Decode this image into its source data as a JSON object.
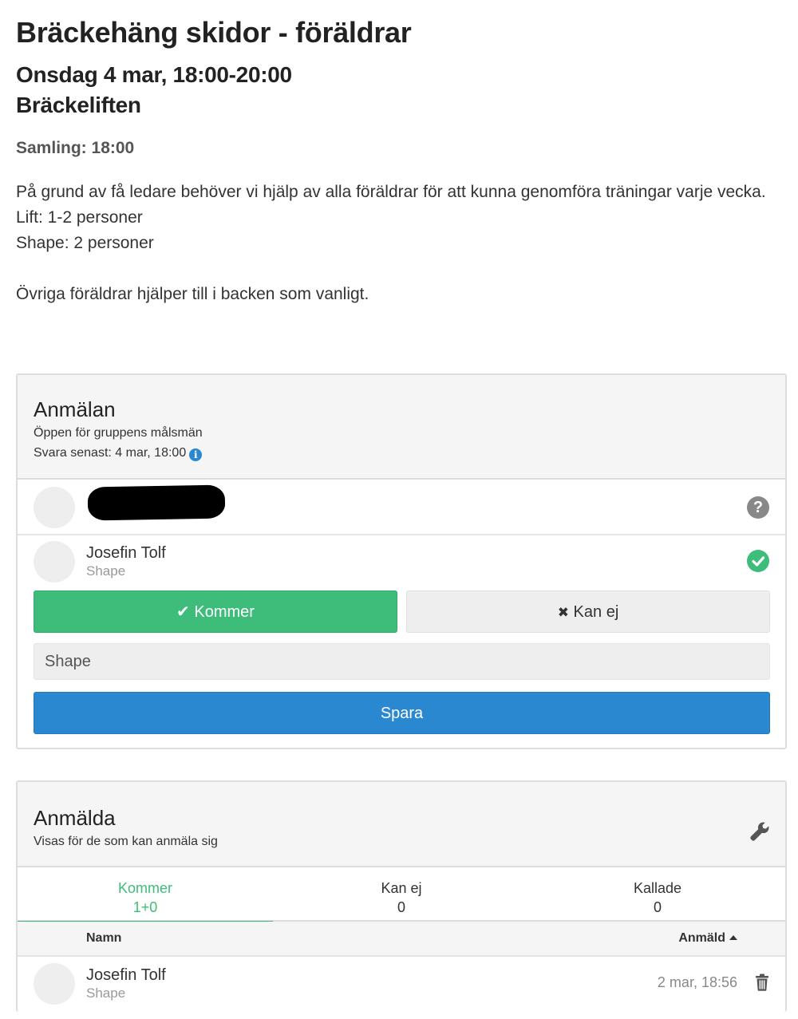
{
  "event": {
    "title": "Bräckehäng skidor - föräldrar",
    "date": "Onsdag 4 mar, 18:00-20:00",
    "location": "Bräckeliften",
    "gathering": "Samling: 18:00",
    "description_lines": [
      "På grund av få ledare behöver vi hjälp av alla föräldrar för att kunna genomföra träningar varje vecka.",
      "Lift: 1-2 personer",
      "Shape: 2 personer",
      "",
      "Övriga föräldrar hjälper till i backen som vanligt."
    ]
  },
  "signup": {
    "title": "Anmälan",
    "subtitle": "Öppen för gruppens målsmän",
    "deadline": "Svara senast: 4 mar, 18:00",
    "info_icon": "info-icon",
    "rows": [
      {
        "name": "",
        "role": "",
        "status": "unanswered",
        "status_icon": "question-circle-icon"
      },
      {
        "name": "Josefin Tolf",
        "role": "Shape",
        "status": "coming",
        "status_icon": "check-circle-icon"
      }
    ],
    "buttons": {
      "coming_icon": "✔",
      "coming_label": "Kommer",
      "cant_icon": "✖",
      "cant_label": "Kan ej",
      "save_label": "Spara"
    },
    "comment_value": "Shape",
    "colors": {
      "coming": "#3ebd7a",
      "save": "#2a88d0",
      "unanswered": "#888888"
    }
  },
  "registered": {
    "title": "Anmälda",
    "subtitle": "Visas för de som kan anmäla sig",
    "tool_icon": "wrench-icon",
    "tabs": [
      {
        "label": "Kommer",
        "count": "1+0",
        "active": true
      },
      {
        "label": "Kan ej",
        "count": "0",
        "active": false
      },
      {
        "label": "Kallade",
        "count": "0",
        "active": false
      }
    ],
    "table": {
      "col_name": "Namn",
      "col_date": "Anmäld",
      "rows": [
        {
          "name": "Josefin Tolf",
          "role": "Shape",
          "date": "2 mar, 18:56"
        }
      ]
    }
  }
}
